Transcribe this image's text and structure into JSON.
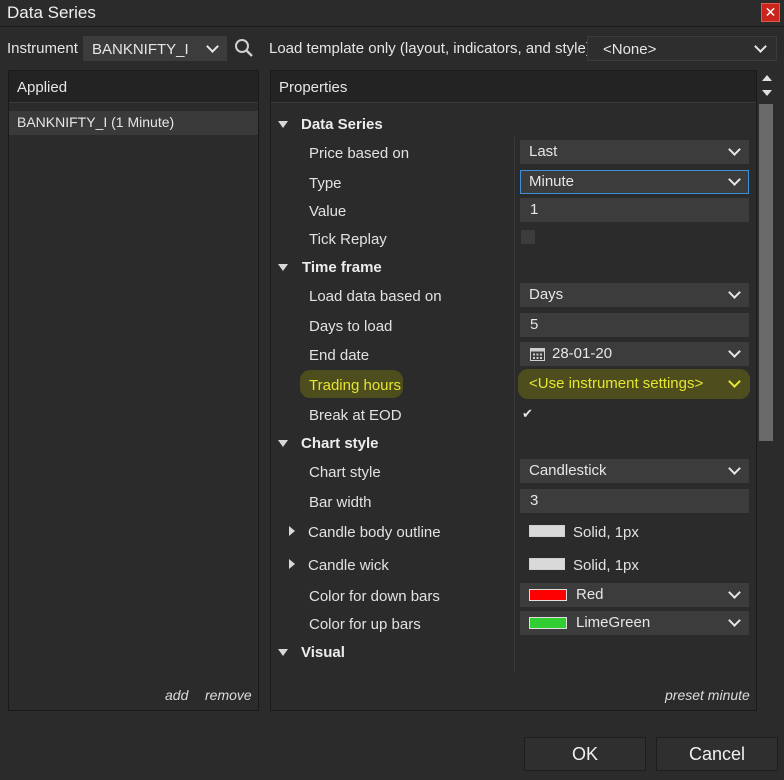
{
  "window": {
    "title": "Data Series",
    "close_glyph": "✕"
  },
  "toolbar": {
    "instrument_label": "Instrument",
    "instrument_value": "BANKNIFTY_I",
    "load_template_label": "Load template only (layout, indicators, and style)",
    "template_value": "<None>"
  },
  "applied": {
    "header": "Applied",
    "items": [
      "BANKNIFTY_I (1 Minute)"
    ],
    "add_label": "add",
    "remove_label": "remove"
  },
  "properties": {
    "header": "Properties",
    "preset_label": "preset minute",
    "categories": {
      "data_series": "Data Series",
      "time_frame": "Time frame",
      "chart_style": "Chart style",
      "visual": "Visual"
    },
    "rows": {
      "price_based_on": {
        "label": "Price based on",
        "value": "Last"
      },
      "type": {
        "label": "Type",
        "value": "Minute"
      },
      "value": {
        "label": "Value",
        "value": "1"
      },
      "tick_replay": {
        "label": "Tick Replay",
        "checked": false
      },
      "load_data_based_on": {
        "label": "Load data based on",
        "value": "Days"
      },
      "days_to_load": {
        "label": "Days to load",
        "value": "5"
      },
      "end_date": {
        "label": "End date",
        "value": "28-01-20"
      },
      "trading_hours": {
        "label": "Trading hours",
        "value": "<Use instrument settings>"
      },
      "break_at_eod": {
        "label": "Break at EOD",
        "checked": true,
        "check_glyph": "✔"
      },
      "chart_style": {
        "label": "Chart style",
        "value": "Candlestick"
      },
      "bar_width": {
        "label": "Bar width",
        "value": "3"
      },
      "candle_body_outline": {
        "label": "Candle body outline",
        "value": "Solid, 1px",
        "color": "#d9d9d9"
      },
      "candle_wick": {
        "label": "Candle wick",
        "value": "Solid, 1px",
        "color": "#d9d9d9"
      },
      "color_down_bars": {
        "label": "Color for down bars",
        "value": "Red",
        "color": "#ff0000"
      },
      "color_up_bars": {
        "label": "Color for up bars",
        "value": "LimeGreen",
        "color": "#32cd32"
      }
    }
  },
  "buttons": {
    "ok": "OK",
    "cancel": "Cancel"
  },
  "colors": {
    "highlight_text": "#e6e62e",
    "focus_border": "#3d8fd6",
    "close": "#c9251c"
  }
}
